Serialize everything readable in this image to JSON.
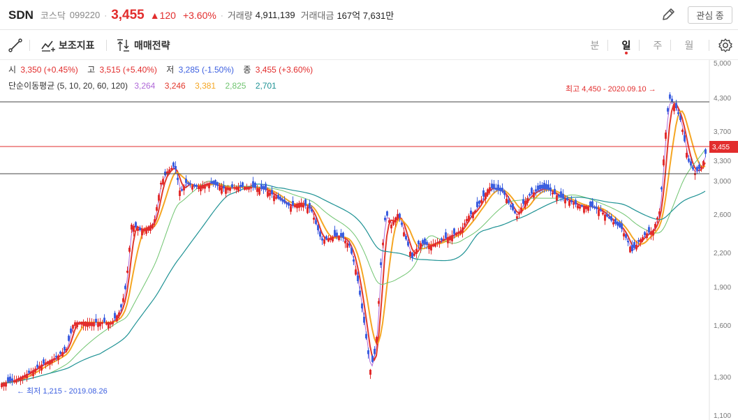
{
  "header": {
    "name": "SDN",
    "market": "코스닥",
    "code": "099220",
    "price": "3,455",
    "change": "▲120",
    "change_pct": "+3.60%",
    "volume_label": "거래량",
    "volume": "4,911,139",
    "amount_label": "거래대금",
    "amount": "167억 7,631만",
    "watch_label": "관심 종"
  },
  "toolbar": {
    "indicator_label": "보조지표",
    "strategy_label": "매매전략",
    "periods": [
      "분",
      "일",
      "주",
      "월"
    ],
    "active_period": "일"
  },
  "ohlc": {
    "open_label": "시",
    "open": "3,350 (+0.45%)",
    "high_label": "고",
    "high": "3,515 (+5.40%)",
    "low_label": "저",
    "low": "3,285 (-1.50%)",
    "close_label": "종",
    "close": "3,455 (+3.60%)"
  },
  "ma": {
    "label": "단순이동평균 (5, 10, 20, 60, 120)",
    "values": [
      "3,264",
      "3,246",
      "3,381",
      "2,825",
      "2,701"
    ],
    "colors": [
      "#b069d8",
      "#e2382c",
      "#f5a623",
      "#6fc46f",
      "#1e9294"
    ]
  },
  "chart_data": {
    "type": "candlestick",
    "y_ticks": [
      "5,000",
      "4,300",
      "3,700",
      "3,300",
      "3,000",
      "2,600",
      "2,200",
      "1,900",
      "1,600",
      "1,300",
      "1,100"
    ],
    "last_price_label": "3,455",
    "max_annotation": "최고 4,450 - 2020.09.10 →",
    "min_annotation": "← 최저 1,215 - 2019.08.26",
    "up_color": "#e22d2d",
    "down_color": "#3c5fe0"
  }
}
